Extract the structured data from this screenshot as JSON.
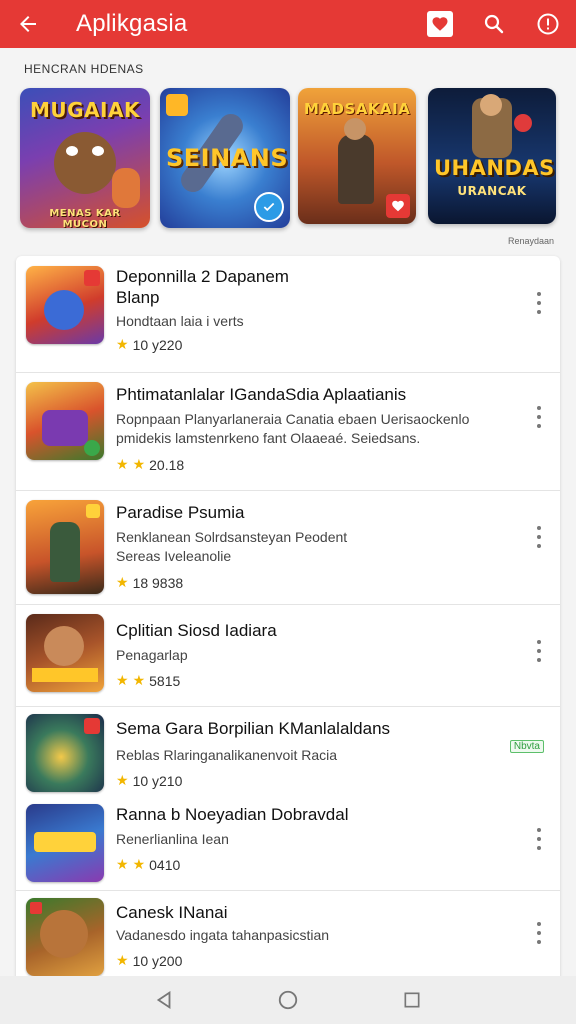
{
  "app_bar": {
    "title": "Aplikgasia",
    "back_icon": "back-arrow-icon",
    "action_icons": [
      "heart-badge-icon",
      "search-icon",
      "info-icon"
    ],
    "color": "#e53935"
  },
  "featured": {
    "section_label": "HENCRAN HDENAS",
    "more_label": "Renaydaan",
    "cards": [
      {
        "title": "MUGAIAK",
        "subtitle": "MENAS KAR MUCON"
      },
      {
        "title": "SEINANS",
        "subtitle": ""
      },
      {
        "title": "MADSAKAIA",
        "subtitle": ""
      },
      {
        "title": "UHANDAS",
        "subtitle": "URANCAK"
      }
    ]
  },
  "apps": [
    {
      "name": "Deponnilla 2 Dapanem Blanp",
      "desc": "Hondtaan laia i verts",
      "rating": "10 y220",
      "stars": 1,
      "more": true
    },
    {
      "name": "Phtimatanlalar IGandaSdia Aplaatianis",
      "desc": "Ropnpaan Planyarlaneraia Canatia ebaen Uerisaockenlo pmidekis lamstenrkeno fant Olaaeaé. Seiedsans.",
      "rating": "20.18",
      "stars": 2,
      "more": true
    },
    {
      "name": "Paradise Psumia",
      "desc": "Renklanean Solrdsansteyan Peodent Sereas Iveleanolie",
      "rating": "18 9838",
      "stars": 1,
      "more": true
    },
    {
      "name": "Cplitian Siosd Iadiara",
      "desc": "Penagarlap",
      "rating": "5815",
      "stars": 2,
      "more": true
    },
    {
      "name": "Sema Gara Borpilian KManlalaldans",
      "desc": "Reblas Rlaringanalikanenvoit Racia",
      "rating": "10 y210",
      "stars": 1,
      "more": false,
      "tag": "Nbvta"
    },
    {
      "name": "Ranna b Noeyadian Dobravdal",
      "desc": "Renerlianlina Iean",
      "rating": "0410",
      "stars": 2,
      "more": true
    },
    {
      "name": "Canesk INanai",
      "desc": "Vadanesdo ingata tahanpasicstian",
      "rating": "10 y200",
      "stars": 1,
      "more": true
    }
  ],
  "nav": {
    "back": "nav-back-icon",
    "home": "nav-home-icon",
    "recent": "nav-recent-icon"
  }
}
